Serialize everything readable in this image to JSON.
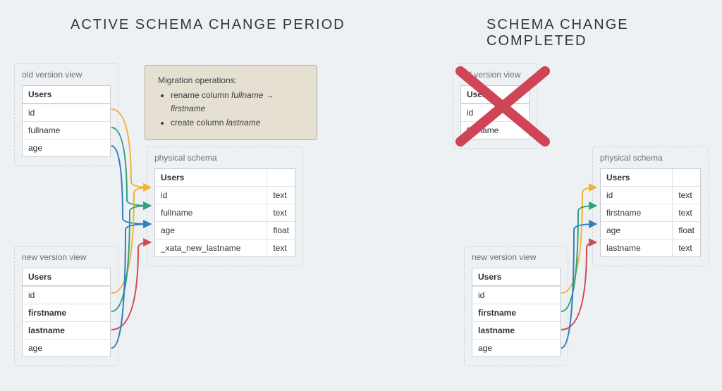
{
  "colors": {
    "yellow": "#f2b138",
    "green": "#32a07b",
    "blue": "#2f7fbf",
    "red": "#d24a4f",
    "x": "#cf4456"
  },
  "left": {
    "title": "ACTIVE SCHEMA CHANGE PERIOD",
    "old_view": {
      "label": "old version view",
      "table": "Users",
      "cols": [
        "id",
        "fullname",
        "age"
      ]
    },
    "new_view": {
      "label": "new version view",
      "table": "Users",
      "cols": [
        "id",
        "firstname",
        "lastname",
        "age"
      ],
      "bold": [
        false,
        true,
        true,
        false
      ]
    },
    "physical": {
      "label": "physical schema",
      "table": "Users",
      "rows": [
        {
          "name": "id",
          "type": "text"
        },
        {
          "name": "fullname",
          "type": "text"
        },
        {
          "name": "age",
          "type": "float"
        },
        {
          "name": "_xata_new_lastname",
          "type": "text"
        }
      ]
    },
    "migration": {
      "heading": "Migration operations:",
      "op1_pre": "rename column ",
      "op1_from": "fullname",
      "op1_arrow": " → ",
      "op1_to": "firstname",
      "op2_pre": "create column ",
      "op2_col": "lastname"
    }
  },
  "right": {
    "title": "SCHEMA CHANGE COMPLETED",
    "old_view": {
      "label": "old version view",
      "table": "Users",
      "cols": [
        "id",
        "fullname"
      ]
    },
    "new_view": {
      "label": "new version view",
      "table": "Users",
      "cols": [
        "id",
        "firstname",
        "lastname",
        "age"
      ],
      "bold": [
        false,
        true,
        true,
        false
      ]
    },
    "physical": {
      "label": "physical schema",
      "table": "Users",
      "rows": [
        {
          "name": "id",
          "type": "text"
        },
        {
          "name": "firstname",
          "type": "text"
        },
        {
          "name": "age",
          "type": "float"
        },
        {
          "name": "lastname",
          "type": "text"
        }
      ]
    }
  }
}
